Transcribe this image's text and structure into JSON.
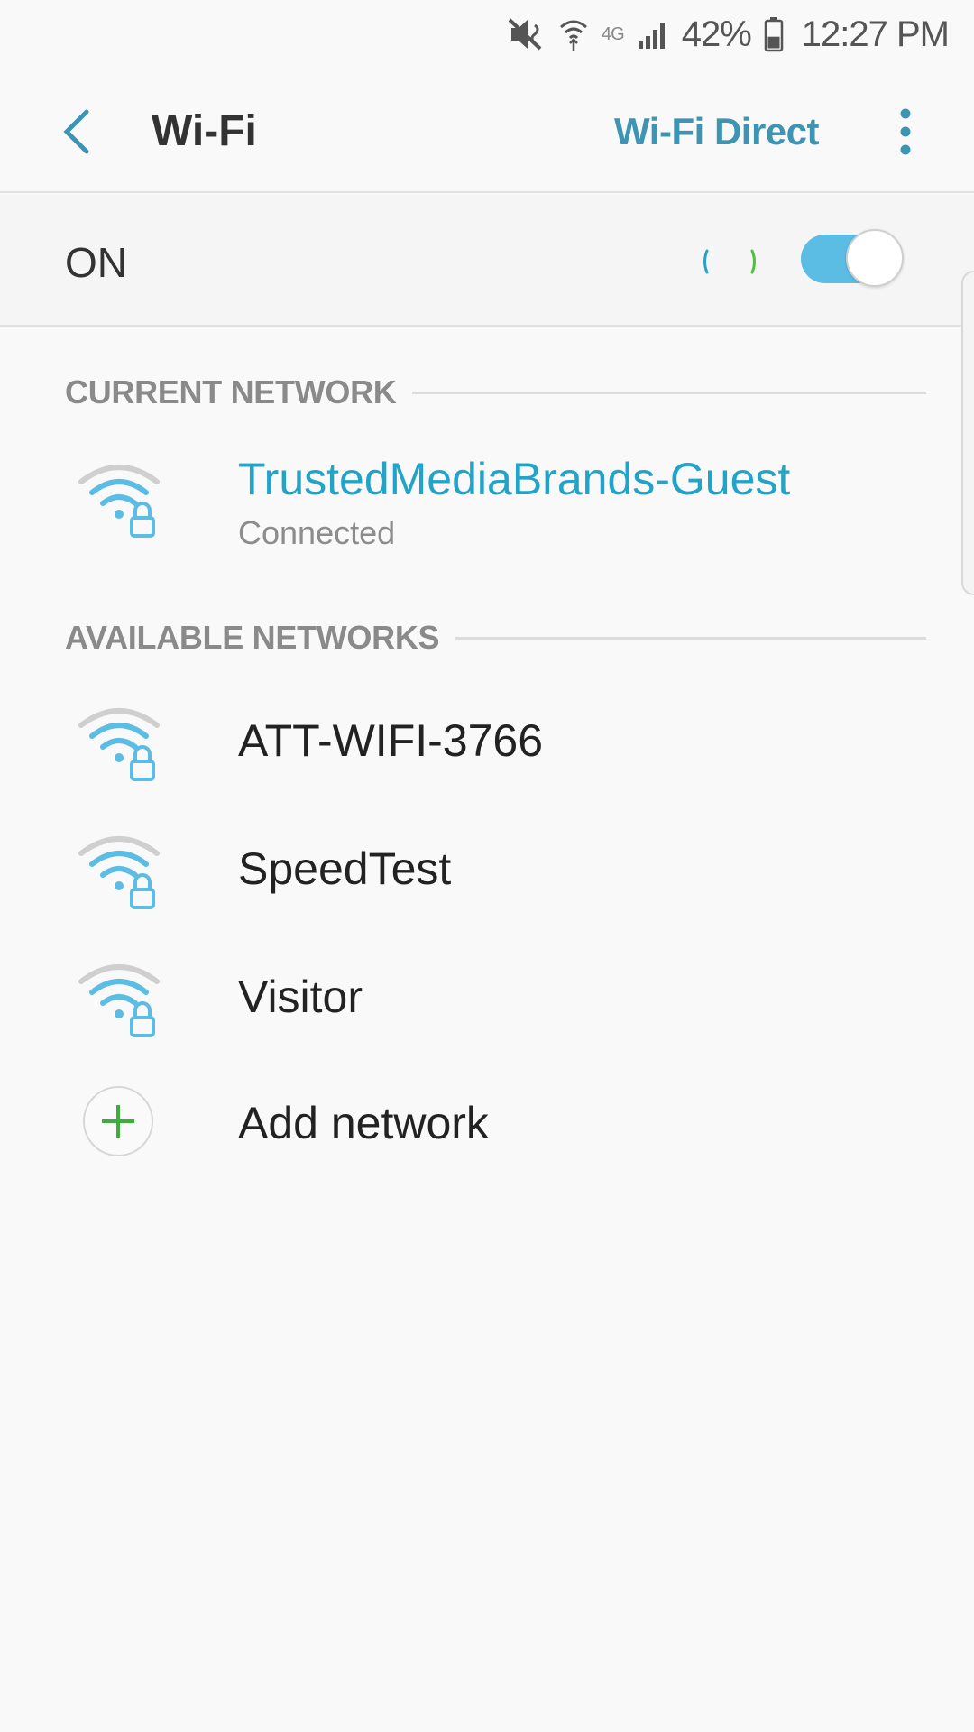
{
  "status_bar": {
    "network_type": "4G",
    "battery_percent": "42%",
    "battery_level": 0.42,
    "time": "12:27 PM",
    "icons": [
      "mute-vibrate-icon",
      "wifi-data-icon",
      "signal-icon",
      "battery-icon"
    ]
  },
  "header": {
    "title": "Wi-Fi",
    "wifi_direct_label": "Wi-Fi Direct",
    "back_icon": "chevron-left-icon",
    "more_icon": "more-vertical-icon"
  },
  "toggle": {
    "label": "ON",
    "state": true,
    "accent_color": "#5bbde4"
  },
  "current_network": {
    "section_title": "CURRENT NETWORK",
    "name": "TrustedMediaBrands-Guest",
    "status": "Connected",
    "accent_color": "#22a4c9"
  },
  "available_networks": {
    "section_title": "AVAILABLE NETWORKS",
    "items": [
      {
        "name": "ATT-WIFI-3766",
        "secured": true
      },
      {
        "name": "SpeedTest",
        "secured": true
      },
      {
        "name": "Visitor",
        "secured": true
      }
    ]
  },
  "add_network": {
    "label": "Add network",
    "icon_color": "#3dae3d"
  }
}
